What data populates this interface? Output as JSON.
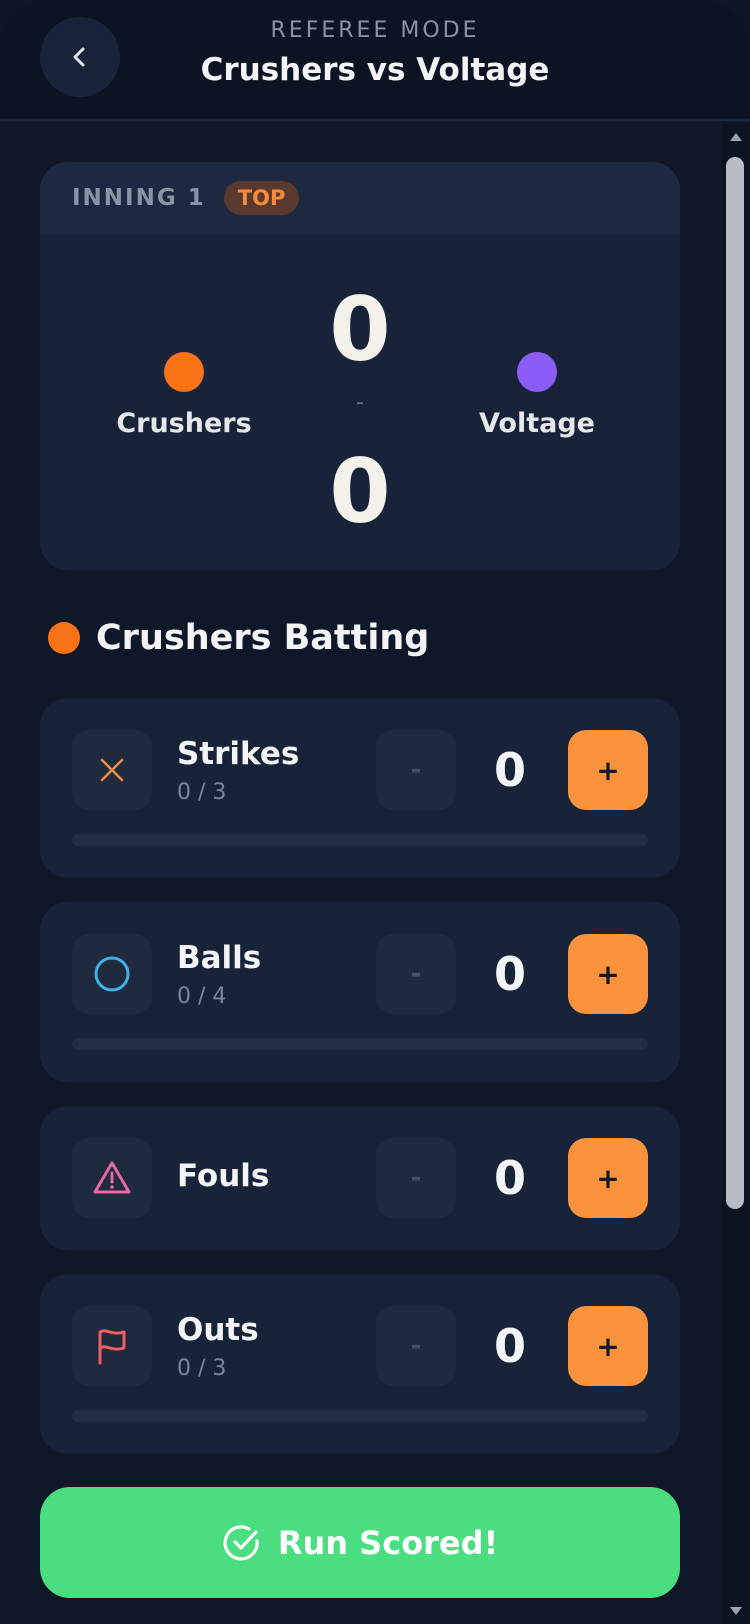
{
  "header": {
    "mode": "REFEREE MODE",
    "title": "Crushers vs Voltage",
    "back_icon": "chevron-left-icon"
  },
  "scoreboard": {
    "inning_label": "INNING 1",
    "half": "TOP",
    "home": {
      "name": "Crushers",
      "color": "#f97316",
      "score": "0"
    },
    "away": {
      "name": "Voltage",
      "color": "#8b5cf6",
      "score": "0"
    },
    "separator": "-"
  },
  "batting": {
    "label": "Crushers Batting",
    "color": "#f97316"
  },
  "counters": [
    {
      "title": "Strikes",
      "subtitle": "0 / 3",
      "value": "0",
      "max": 3,
      "progress": 0,
      "icon": "x-icon",
      "icon_color": "#f08a3f",
      "minus": "-",
      "plus": "+"
    },
    {
      "title": "Balls",
      "subtitle": "0 / 4",
      "value": "0",
      "max": 4,
      "progress": 0,
      "icon": "circle-icon",
      "icon_color": "#3fb0e8",
      "minus": "-",
      "plus": "+"
    },
    {
      "title": "Fouls",
      "value": "0",
      "icon": "warning-triangle-icon",
      "icon_color": "#e56aa6",
      "minus": "-",
      "plus": "+"
    },
    {
      "title": "Outs",
      "subtitle": "0 / 3",
      "value": "0",
      "max": 3,
      "progress": 0,
      "icon": "flag-icon",
      "icon_color": "#ef5f5f",
      "minus": "-",
      "plus": "+"
    }
  ],
  "run_button": {
    "label": "Run Scored!",
    "icon": "check-circle-icon",
    "color": "#4ade80"
  },
  "colors": {
    "accent": "#fb923c",
    "background": "#0f1728",
    "card": "#18233a"
  }
}
